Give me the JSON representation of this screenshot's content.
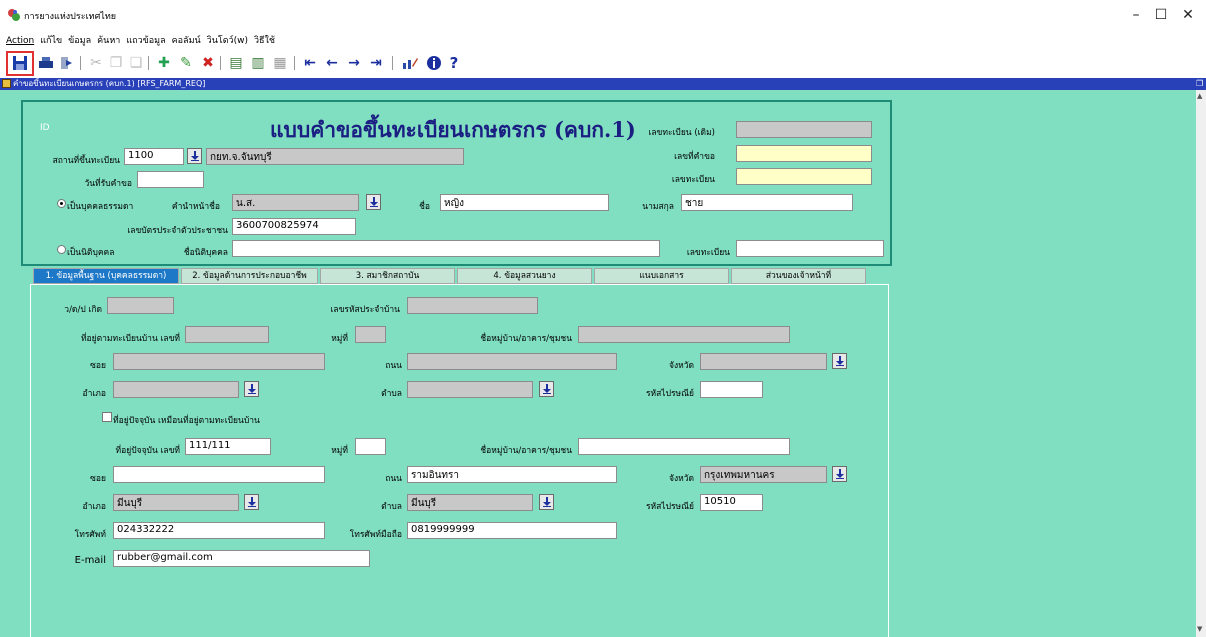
{
  "window": {
    "title": "การยางแห่งประเทศไทย",
    "minimize": "–",
    "maximize": "☐",
    "close": "✕"
  },
  "menu": [
    "Action",
    "แก้ไข",
    "ข้อมูล",
    "ค้นหา",
    "แถวข้อมูล",
    "คอลัมน์",
    "วินโดว์(w)",
    "วิธีใช้"
  ],
  "form": {
    "window_title": "คำขอขึ้นทะเบียนเกษตรกร (คบก.1) [RFS_FARM_REQ]",
    "id_label": "ID",
    "heading": "แบบคำขอขึ้นทะเบียนเกษตรกร (คบก.1)",
    "reg_old_label": "เลขทะเบียน (เดิม)",
    "request_no_label": "เลขที่คำขอ",
    "reg_no_label": "เลขทะเบียน",
    "place_label": "สถานที่ขึ้นทะเบียน",
    "place_code": "1100",
    "place_name": "กยท.จ.จันทบุรี",
    "receive_date_label": "วันที่รับคำขอ",
    "person_radio": "เป็นบุคคลธรรมดา",
    "prefix_label": "คำนำหน้าชื่อ",
    "prefix_value": "น.ส.",
    "firstname_label": "ชื่อ",
    "firstname_value": "หญิง",
    "lastname_label": "นามสกุล",
    "lastname_value": "ชาย",
    "idcard_label": "เลขบัตรประจำตัวประชาชน",
    "idcard_value": "3600700825974",
    "juristic_radio": "เป็นนิติบุคคล",
    "juristic_name_label": "ชื่อนิติบุคคล",
    "juristic_reg_label": "เลขทะเบียน"
  },
  "tabs": [
    "1. ข้อมูลพื้นฐาน (บุคคลธรรมดา)",
    "2. ข้อมูลด้านการประกอบอาชีพ",
    "3. สมาชิกสถาบัน",
    "4. ข้อมูลสวนยาง",
    "แนบเอกสาร",
    "ส่วนของเจ้าหน้าที่"
  ],
  "tab1": {
    "dob_label": "ว/ด/ป เกิด",
    "house_code_label": "เลขรหัสประจำบ้าน",
    "reg_addr_label": "ที่อยู่ตามทะเบียนบ้าน เลขที่",
    "moo_label": "หมู่ที่",
    "village_label": "ชื่อหมู่บ้าน/อาคาร/ชุมชน",
    "soi_label": "ซอย",
    "road_label": "ถนน",
    "province_label": "จังหวัด",
    "amphoe_label": "อำเภอ",
    "tambon_label": "ตำบล",
    "postcode_label": "รหัสไปรษณีย์",
    "same_addr_label": "ที่อยู่ปัจจุบัน เหมือนที่อยู่ตามทะเบียนบ้าน",
    "cur_addr_label": "ที่อยู่ปัจจุบัน เลขที่",
    "cur_addr_value": "111/111",
    "cur_road_value": "รามอินทรา",
    "cur_province_value": "กรุงเทพมหานคร",
    "cur_amphoe_value": "มีนบุรี",
    "cur_tambon_value": "มีนบุรี",
    "cur_postcode_value": "10510",
    "phone_label": "โทรศัพท์",
    "phone_value": "024332222",
    "mobile_label": "โทรศัพท์มือถือ",
    "mobile_value": "0819999999",
    "email_label": "E-mail",
    "email_value": "rubber@gmail.com"
  }
}
